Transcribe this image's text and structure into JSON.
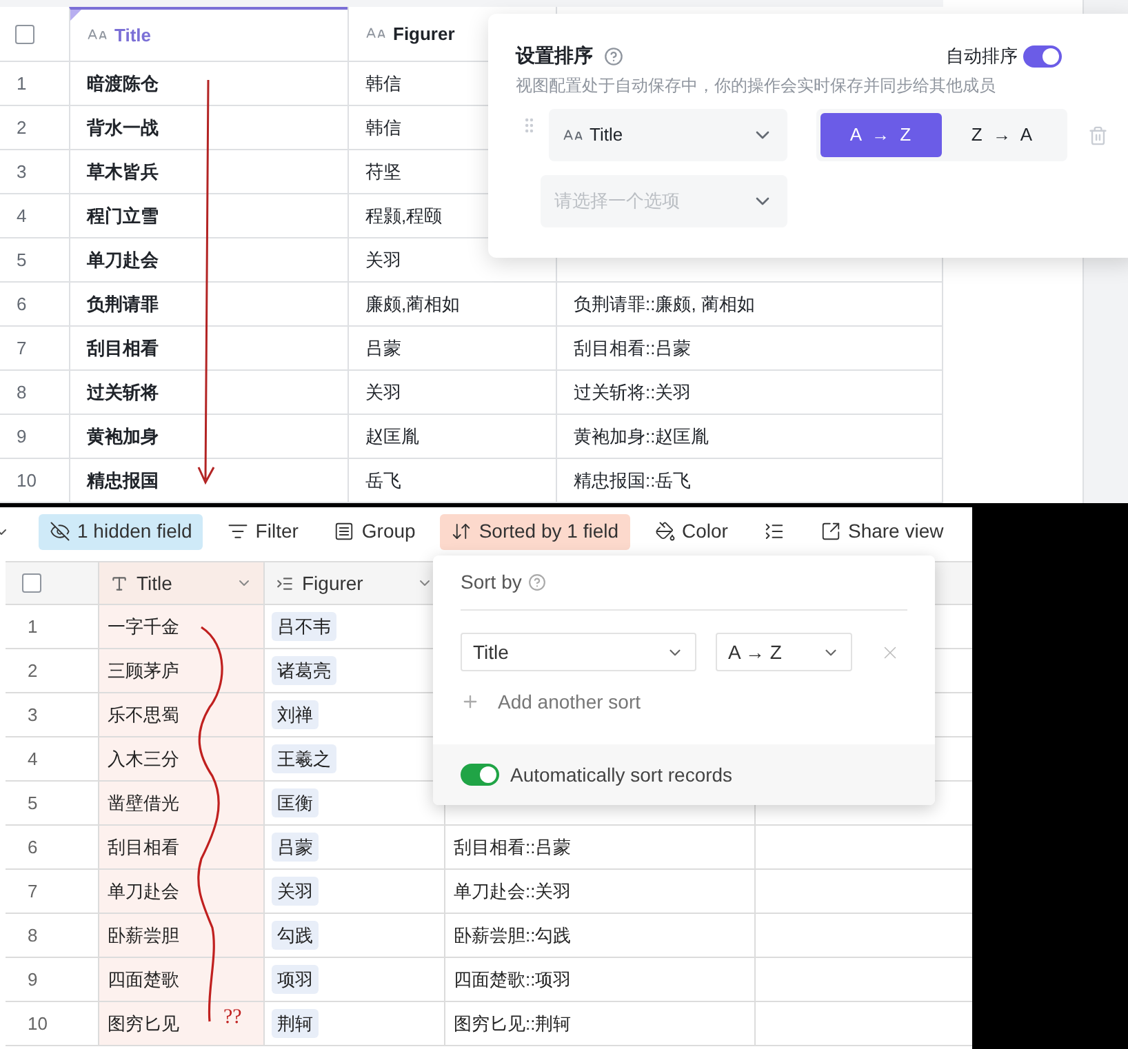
{
  "top_view": {
    "select_all": {
      "checked": false
    },
    "columns": [
      {
        "label": "Title",
        "selected": true
      },
      {
        "label": "Figurer",
        "selected": false
      }
    ],
    "rows": [
      {
        "number": "1",
        "title": "暗渡陈仓",
        "figurer": "韩信"
      },
      {
        "number": "2",
        "title": "背水一战",
        "figurer": "韩信"
      },
      {
        "number": "3",
        "title": "草木皆兵",
        "figurer": "苻坚"
      },
      {
        "number": "4",
        "title": "程门立雪",
        "figurer": "程颢,程颐"
      },
      {
        "number": "5",
        "title": "单刀赴会",
        "figurer": "关羽"
      },
      {
        "number": "6",
        "title": "负荆请罪",
        "figurer": "廉颇,蔺相如",
        "combined": "负荆请罪::廉颇, 蔺相如"
      },
      {
        "number": "7",
        "title": "刮目相看",
        "figurer": "吕蒙",
        "combined": "刮目相看::吕蒙"
      },
      {
        "number": "8",
        "title": "过关斩将",
        "figurer": "关羽",
        "combined": "过关斩将::关羽"
      },
      {
        "number": "9",
        "title": "黄袍加身",
        "figurer": "赵匡胤",
        "combined": "黄袍加身::赵匡胤"
      },
      {
        "number": "10",
        "title": "精忠报国",
        "figurer": "岳飞",
        "combined": "精忠报国::岳飞"
      }
    ],
    "sort_panel": {
      "title": "设置排序",
      "auto_sort": {
        "label": "自动排序",
        "on": true
      },
      "subtitle": "视图配置处于自动保存中，你的操作会实时保存并同步给其他成员",
      "field": "Title",
      "directions": [
        {
          "label": "A → Z",
          "selected": true
        },
        {
          "label": "Z → A",
          "selected": false
        }
      ],
      "new_field": {
        "placeholder": "请选择一个选项"
      }
    }
  },
  "bottom_view": {
    "toolbar": [
      {
        "kind": "hidden",
        "label": "1 hidden field"
      },
      {
        "kind": "filter",
        "label": "Filter"
      },
      {
        "kind": "group",
        "label": "Group"
      },
      {
        "kind": "sort",
        "label": "Sorted by 1 field"
      },
      {
        "kind": "color",
        "label": "Color"
      },
      {
        "kind": "row_height"
      },
      {
        "kind": "share",
        "label": "Share view"
      }
    ],
    "select_all": {
      "checked": false
    },
    "columns": [
      {
        "label": "Title",
        "kind": "text"
      },
      {
        "label": "Figurer",
        "kind": "lookup"
      }
    ],
    "rows": [
      {
        "number": "1",
        "title": "一字千金",
        "figurer": "吕不韦"
      },
      {
        "number": "2",
        "title": "三顾茅庐",
        "figurer": "诸葛亮"
      },
      {
        "number": "3",
        "title": "乐不思蜀",
        "figurer": "刘禅"
      },
      {
        "number": "4",
        "title": "入木三分",
        "figurer": "王羲之"
      },
      {
        "number": "5",
        "title": "凿壁借光",
        "figurer": "匡衡"
      },
      {
        "number": "6",
        "title": "刮目相看",
        "figurer": "吕蒙",
        "combined": "刮目相看::吕蒙"
      },
      {
        "number": "7",
        "title": "单刀赴会",
        "figurer": "关羽",
        "combined": "单刀赴会::关羽"
      },
      {
        "number": "8",
        "title": "卧薪尝胆",
        "figurer": "勾践",
        "combined": "卧薪尝胆::勾践"
      },
      {
        "number": "9",
        "title": "四面楚歌",
        "figurer": "项羽",
        "combined": "四面楚歌::项羽"
      },
      {
        "number": "10",
        "title": "图穷匕见",
        "figurer": "荆轲",
        "combined": "图穷匕见::荆轲"
      }
    ],
    "sort_panel": {
      "title": "Sort by",
      "field": "Title",
      "direction": "A → Z",
      "add_label": "Add another sort",
      "auto_sort": {
        "label": "Automatically sort records",
        "on": true
      }
    },
    "annotation": {
      "text": "??"
    }
  }
}
